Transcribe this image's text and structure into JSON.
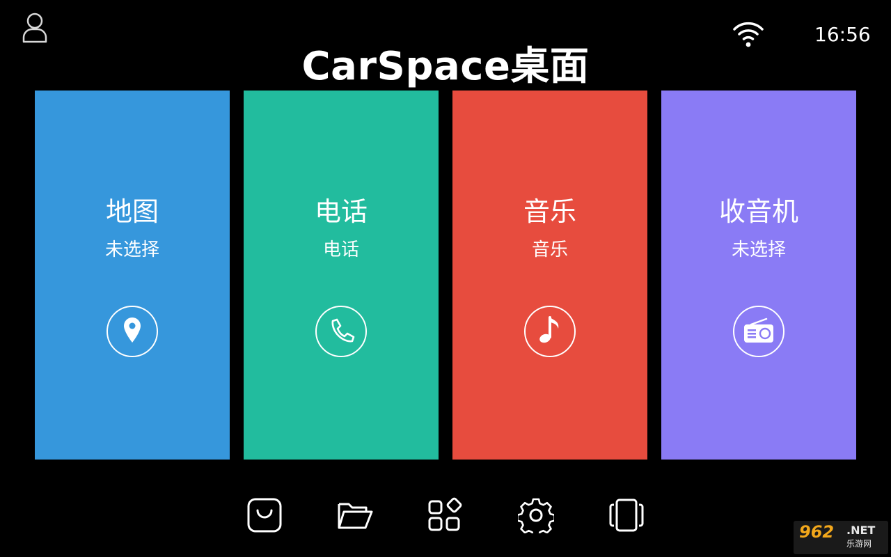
{
  "header": {
    "title": "CarSpace桌面",
    "clock": "16:56"
  },
  "tiles": [
    {
      "title": "地图",
      "subtitle": "未选择",
      "icon": "map-pin-icon",
      "color": "#3697DC"
    },
    {
      "title": "电话",
      "subtitle": "电话",
      "icon": "phone-icon",
      "color": "#22BC9E"
    },
    {
      "title": "音乐",
      "subtitle": "音乐",
      "icon": "music-note-icon",
      "color": "#E74C3E"
    },
    {
      "title": "收音机",
      "subtitle": "未选择",
      "icon": "radio-icon",
      "color": "#8A7BF5"
    }
  ],
  "dock": [
    {
      "icon": "shopping-bag-icon"
    },
    {
      "icon": "folder-open-icon"
    },
    {
      "icon": "apps-grid-icon"
    },
    {
      "icon": "settings-gear-icon"
    },
    {
      "icon": "multi-window-icon"
    }
  ],
  "watermark": {
    "brand": "962",
    "suffix": ".NET",
    "name": "乐游网"
  }
}
